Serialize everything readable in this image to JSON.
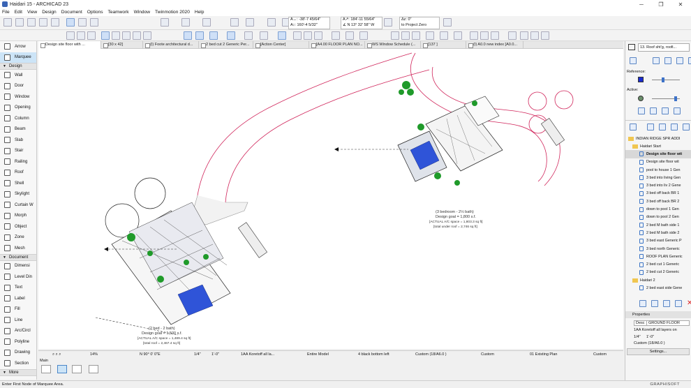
{
  "title": "Haidari 15 - ARCHICAD 23",
  "menus": [
    "File",
    "Edit",
    "View",
    "Design",
    "Document",
    "Options",
    "Teamwork",
    "Window",
    "Twinmotion 2020",
    "Help"
  ],
  "coords": {
    "ax": "A↔: -38'-7 45/64\"",
    "ay": "A↕: 160'-4 5/32\"",
    "ar": "A↗: 184'-11 55/64\"",
    "aa": "∡ N 13° 32' 58\" W",
    "az": "Δz: 0\"",
    "zref": "to Project Zero"
  },
  "toolbox": [
    {
      "type": "tool",
      "label": "Arrow"
    },
    {
      "type": "tool",
      "label": "Marquee",
      "selected": true
    },
    {
      "type": "group",
      "label": "Design"
    },
    {
      "type": "tool",
      "label": "Wall"
    },
    {
      "type": "tool",
      "label": "Door"
    },
    {
      "type": "tool",
      "label": "Window"
    },
    {
      "type": "tool",
      "label": "Opening"
    },
    {
      "type": "tool",
      "label": "Column"
    },
    {
      "type": "tool",
      "label": "Beam"
    },
    {
      "type": "tool",
      "label": "Slab"
    },
    {
      "type": "tool",
      "label": "Stair"
    },
    {
      "type": "tool",
      "label": "Railing"
    },
    {
      "type": "tool",
      "label": "Roof"
    },
    {
      "type": "tool",
      "label": "Shell"
    },
    {
      "type": "tool",
      "label": "Skylight"
    },
    {
      "type": "tool",
      "label": "Curtain W"
    },
    {
      "type": "tool",
      "label": "Morph"
    },
    {
      "type": "tool",
      "label": "Object"
    },
    {
      "type": "tool",
      "label": "Zone"
    },
    {
      "type": "tool",
      "label": "Mesh"
    },
    {
      "type": "group",
      "label": "Document"
    },
    {
      "type": "tool",
      "label": "Dimensi"
    },
    {
      "type": "tool",
      "label": "Level Din"
    },
    {
      "type": "tool",
      "label": "Text"
    },
    {
      "type": "tool",
      "label": "Label"
    },
    {
      "type": "tool",
      "label": "Fill"
    },
    {
      "type": "tool",
      "label": "Line"
    },
    {
      "type": "tool",
      "label": "Arc/Circl"
    },
    {
      "type": "tool",
      "label": "Polyline"
    },
    {
      "type": "tool",
      "label": "Drawing"
    },
    {
      "type": "tool",
      "label": "Section"
    },
    {
      "type": "group",
      "label": "More"
    }
  ],
  "tabs": [
    {
      "label": "Design site floor with ...",
      "active": true
    },
    {
      "label": "[30 x 42]"
    },
    {
      "label": "(I) Foote architectural d..."
    },
    {
      "label": "2 bed cut 2 Generic Per..."
    },
    {
      "label": "[Action Center]"
    },
    {
      "label": "[A4.00 FLOOR PLAN NO..."
    },
    {
      "label": "WS Window Schedule (..."
    },
    {
      "label": "[137 ]"
    },
    {
      "label": "(I) A0.0 new index [A0.0..."
    }
  ],
  "annotations": {
    "top": [
      "(3 bedroom - 2½ bath)",
      "Design goal = 1,800 s.f.",
      "[ACTUAL A/C space = 1,803.3 sq ft]",
      "[total under roof = 2,746 sq ft]"
    ],
    "bottom": [
      "(2 bed - 2 bath)",
      "Design goal = 1,500 s.f.",
      "[ACTUAL A/C space = 1,489.4 sq ft]",
      "[total roof = 2,467.4 sq ft]"
    ]
  },
  "status": {
    "zoom": "14%",
    "angle": "N 90° 0' 0\"E",
    "scale_a": "1/4\"",
    "scale_b": "1'-0\"",
    "layers": "1AA Koretoff all la...",
    "model": "Entire Model",
    "penset": "4 black bottom left",
    "custom1": "Custom (18/A6.0 )",
    "custom2": "Custom",
    "renov": "01 Existing Plan",
    "custom3": "Custom",
    "main": "Main"
  },
  "hint": "Enter First Node of Marquee Area.",
  "brand": "GRAPHISOFT",
  "rpanel": {
    "header": "13. Roof sht'g, roofi...",
    "reference": "Reference:",
    "active": "Active:",
    "project": "INDIAN RIDGE SPR ADDI",
    "nav": [
      {
        "label": "Haidari Start",
        "kind": "folder"
      },
      {
        "label": "Design site floor wit",
        "kind": "doc",
        "selected": true
      },
      {
        "label": "Design site floor wit",
        "kind": "doc"
      },
      {
        "label": "pool to house 1 Gen",
        "kind": "doc"
      },
      {
        "label": "3 bed into living Gen",
        "kind": "doc"
      },
      {
        "label": "3 bed into liv 2 Gene",
        "kind": "doc"
      },
      {
        "label": "3 bed off back BR 1",
        "kind": "doc"
      },
      {
        "label": "3 bed off back BR 2",
        "kind": "doc"
      },
      {
        "label": "down to pool 1 Gen",
        "kind": "doc"
      },
      {
        "label": "down to pool 2 Gen",
        "kind": "doc"
      },
      {
        "label": "2 bed M bath side 1",
        "kind": "doc"
      },
      {
        "label": "2 bed M bath side 2",
        "kind": "doc"
      },
      {
        "label": "3 bed east Generic P",
        "kind": "doc"
      },
      {
        "label": "3 bed north Generic",
        "kind": "doc"
      },
      {
        "label": "ROOF PLAN Generic",
        "kind": "doc"
      },
      {
        "label": "2 bed cut 1 Generic",
        "kind": "doc"
      },
      {
        "label": "2 bed cut 2 Generic",
        "kind": "doc"
      },
      {
        "label": "Haidari 2",
        "kind": "folder"
      },
      {
        "label": "2 bed east side Gene",
        "kind": "doc"
      }
    ],
    "properties": "Properties",
    "prop_desc": "Desc",
    "prop_value": "GROUND FLOOR",
    "prop_layers": "1AA Koretoff all layers on",
    "prop_scale_a": "1/4\"",
    "prop_scale_b": "1'-0\"",
    "prop_custom": "Custom (18/A6.0 )",
    "settings": "Settings..."
  },
  "colors": {
    "accent": "#2f6fce",
    "grass": "#1f9a2a",
    "road": "#d0245a",
    "pool": "#2f54d8"
  }
}
